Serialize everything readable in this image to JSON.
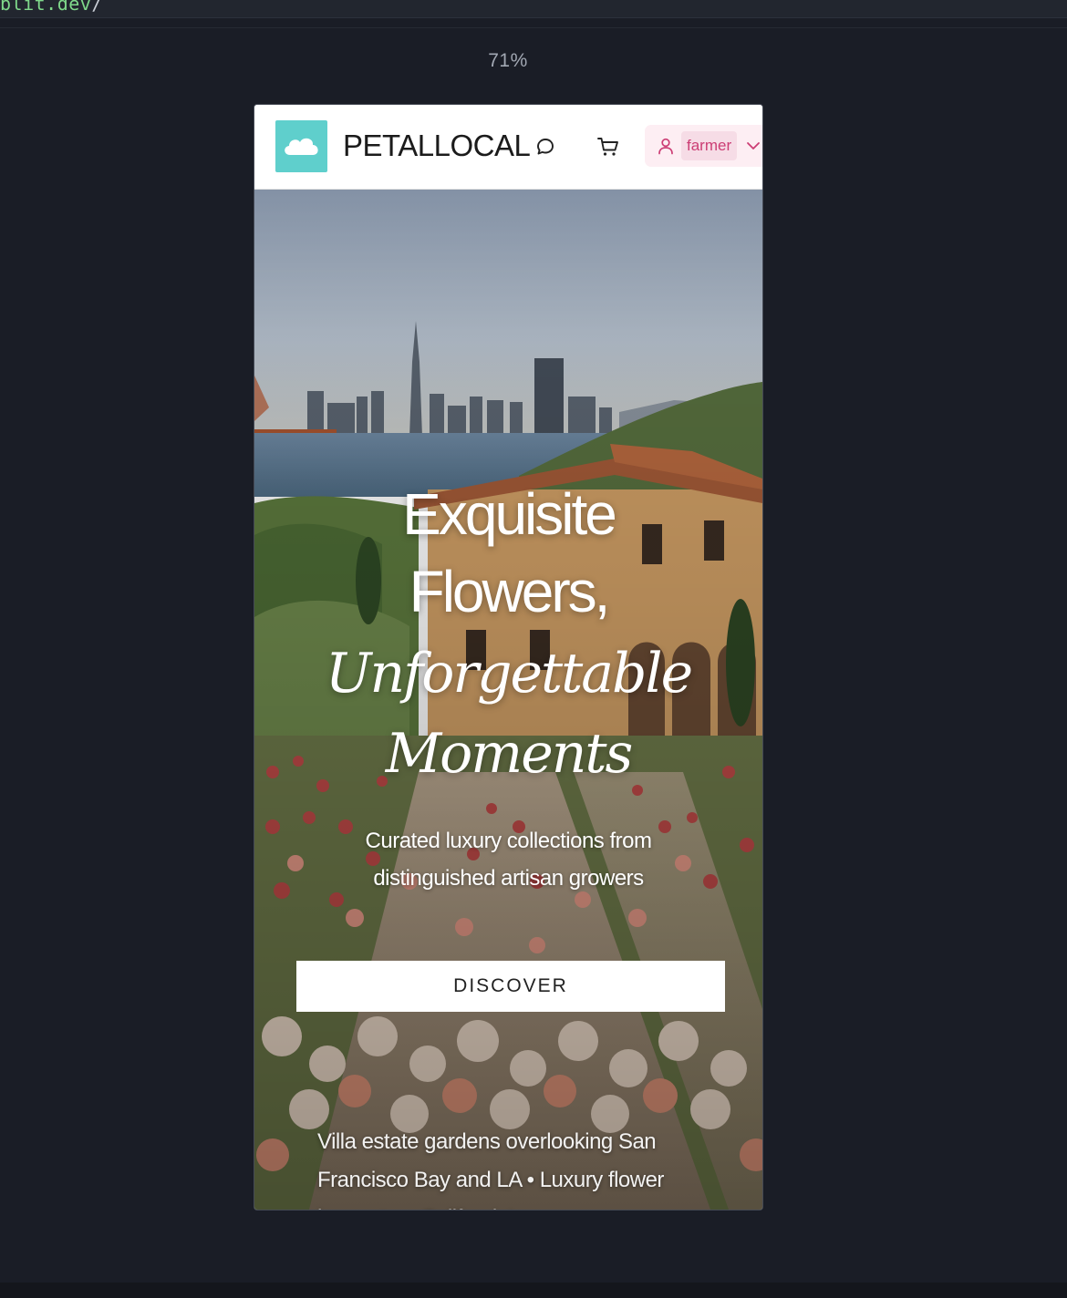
{
  "browser": {
    "url_fragment": "blit.dev",
    "url_slash": "/",
    "zoom_level": "71%"
  },
  "header": {
    "brand": "PETALLOCAL",
    "user_name": "farmer",
    "icons": [
      "cloud-logo-icon",
      "chat-icon",
      "cart-icon",
      "user-icon",
      "chevron-down-icon"
    ]
  },
  "hero": {
    "title_line1": "Exquisite",
    "title_line2": "Flowers,",
    "title_line3": "Unforgettable",
    "title_line4": "Moments",
    "subtitle": "Curated luxury collections from distinguished artisan growers",
    "cta_label": "DISCOVER",
    "caption": "Villa estate gardens overlooking San Francisco Bay and LA • Luxury flower harvest on California's ..."
  },
  "colors": {
    "page_bg": "#1a1d26",
    "accent_teal": "#5fcfcc",
    "user_pill_bg": "#fdeef3",
    "user_text": "#cc3d74"
  }
}
